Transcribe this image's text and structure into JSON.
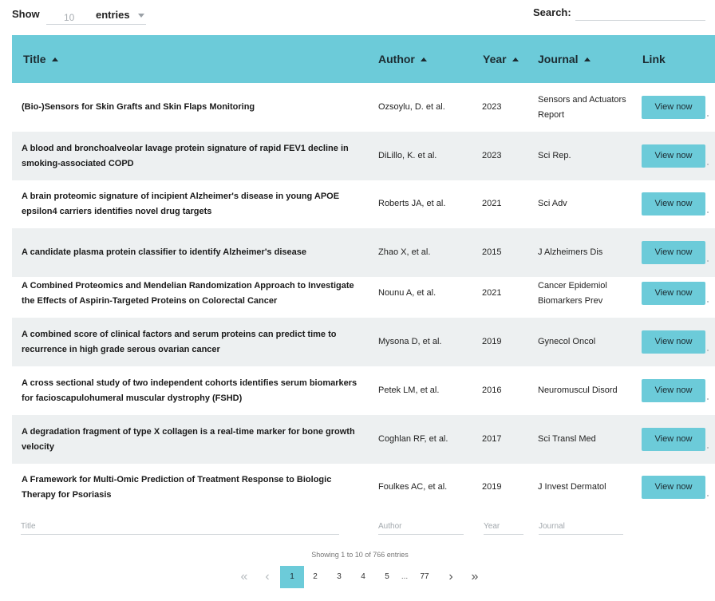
{
  "length_control": {
    "show_label": "Show",
    "value": "10",
    "entries_label": "entries"
  },
  "search": {
    "label": "Search:",
    "value": "",
    "placeholder": ""
  },
  "table": {
    "columns": [
      "Title",
      "Author",
      "Year",
      "Journal",
      "Link"
    ],
    "rows": [
      {
        "title": "(Bio-)Sensors for Skin Grafts and Skin Flaps Monitoring",
        "author": "Ozsoylu, D. et al.",
        "year": "2023",
        "journal": "Sensors and Actuators Report",
        "link": "View now"
      },
      {
        "title": "A blood and bronchoalveolar lavage protein signature of rapid FEV1 decline in smoking-associated COPD",
        "author": "DiLillo, K. et al.",
        "year": "2023",
        "journal": "Sci Rep.",
        "link": "View now"
      },
      {
        "title": "A brain proteomic signature of incipient Alzheimer's disease in young APOE epsilon4 carriers identifies novel drug targets",
        "author": "Roberts JA, et al.",
        "year": "2021",
        "journal": "Sci Adv",
        "link": "View now"
      },
      {
        "title": "A candidate plasma protein classifier to identify Alzheimer's disease",
        "author": "Zhao X, et al.",
        "year": "2015",
        "journal": "J Alzheimers Dis",
        "link": "View now"
      },
      {
        "title": "A Combined Proteomics and Mendelian Randomization Approach to Investigate the Effects of Aspirin-Targeted Proteins on Colorectal Cancer",
        "author": "Nounu A, et al.",
        "year": "2021",
        "journal": "Cancer Epidemiol Biomarkers Prev",
        "link": "View now"
      },
      {
        "title": "A combined score of clinical factors and serum proteins can predict time to recurrence in high grade serous ovarian cancer",
        "author": "Mysona D, et al.",
        "year": "2019",
        "journal": "Gynecol Oncol",
        "link": "View now"
      },
      {
        "title": "A cross sectional study of two independent cohorts identifies serum biomarkers for facioscapulohumeral muscular dystrophy (FSHD)",
        "author": "Petek LM, et al.",
        "year": "2016",
        "journal": "Neuromuscul Disord",
        "link": "View now"
      },
      {
        "title": "A degradation fragment of type X collagen is a real-time marker for bone growth velocity",
        "author": "Coghlan RF, et al.",
        "year": "2017",
        "journal": "Sci Transl Med",
        "link": "View now"
      },
      {
        "title": "A Framework for Multi-Omic Prediction of Treatment Response to Biologic Therapy for Psoriasis",
        "author": "Foulkes AC, et al.",
        "year": "2019",
        "journal": "J Invest Dermatol",
        "link": "View now"
      }
    ],
    "footer_filters": {
      "title": "Title",
      "author": "Author",
      "year": "Year",
      "journal": "Journal"
    }
  },
  "info": "Showing 1 to 10 of 766 entries",
  "pagination": {
    "first_icon": "double-chevron-left-icon",
    "prev_icon": "chevron-left-icon",
    "pages": [
      "1",
      "2",
      "3",
      "4",
      "5"
    ],
    "ellipsis": "...",
    "last_page": "77",
    "current": "1",
    "next_icon": "chevron-right-icon",
    "last_icon": "double-chevron-right-icon"
  },
  "colors": {
    "accent": "#6ccbd9",
    "row_alt": "#edf0f1"
  }
}
